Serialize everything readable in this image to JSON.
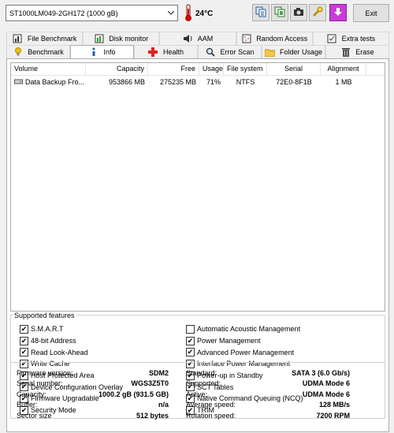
{
  "toolbar": {
    "drive": "ST1000LM049-2GH172 (1000 gB)",
    "temperature": "24°C",
    "exit_label": "Exit"
  },
  "tabs_top": [
    {
      "label": "File Benchmark",
      "icon": "file-benchmark-icon"
    },
    {
      "label": "Disk monitor",
      "icon": "disk-monitor-icon"
    },
    {
      "label": "AAM",
      "icon": "speaker-icon"
    },
    {
      "label": "Random Access",
      "icon": "random-access-icon"
    },
    {
      "label": "Extra tests",
      "icon": "extra-tests-icon"
    }
  ],
  "tabs_bottom": [
    {
      "label": "Benchmark",
      "icon": "benchmark-icon"
    },
    {
      "label": "Info",
      "icon": "info-icon",
      "active": true
    },
    {
      "label": "Health",
      "icon": "health-cross-icon"
    },
    {
      "label": "Error Scan",
      "icon": "magnifier-icon"
    },
    {
      "label": "Folder Usage",
      "icon": "folder-icon"
    },
    {
      "label": "Erase",
      "icon": "trash-icon"
    }
  ],
  "volumes": {
    "headers": [
      "Volume",
      "Capacity",
      "Free",
      "Usage",
      "File system",
      "Serial",
      "Alignment"
    ],
    "rows": [
      [
        "Data Backup Fro...",
        "953866 MB",
        "275235 MB",
        "71%",
        "NTFS",
        "72E0-8F1B",
        "1 MB"
      ]
    ]
  },
  "features": {
    "title": "Supported features",
    "left": [
      {
        "label": "S.M.A.R.T",
        "checked": true
      },
      {
        "label": "48-bit Address",
        "checked": true
      },
      {
        "label": "Read Look-Ahead",
        "checked": true
      },
      {
        "label": "Write Cache",
        "checked": true
      },
      {
        "label": "Host Protected Area",
        "checked": true
      },
      {
        "label": "Device Configuration Overlay",
        "checked": true
      },
      {
        "label": "Firmware Upgradable",
        "checked": true
      },
      {
        "label": "Security Mode",
        "checked": true
      }
    ],
    "right": [
      {
        "label": "Automatic Acoustic Management",
        "checked": false
      },
      {
        "label": "Power Management",
        "checked": true
      },
      {
        "label": "Advanced Power Management",
        "checked": true
      },
      {
        "label": "Interface Power Management",
        "checked": true
      },
      {
        "label": "Power-up in Standby",
        "checked": true
      },
      {
        "label": "SCT Tables",
        "checked": true
      },
      {
        "label": "Native Command Queuing (NCQ)",
        "checked": true
      },
      {
        "label": "TRIM",
        "checked": true
      }
    ]
  },
  "info": {
    "left": [
      {
        "label": "Firmware version:",
        "value": "SDM2"
      },
      {
        "label": "Serial number:",
        "value": "WGS3Z5T0"
      },
      {
        "label": "Capacity:",
        "value": "1000.2 gB (931.5 GB)"
      },
      {
        "label": "Buffer:",
        "value": "n/a"
      },
      {
        "label": "Sector size",
        "value": "512 bytes"
      }
    ],
    "right": [
      {
        "label": "Standard:",
        "value": "SATA 3 (6.0 Gb/s)"
      },
      {
        "label": "Supported:",
        "value": "UDMA Mode 6"
      },
      {
        "label": "Active:",
        "value": "UDMA Mode 6"
      },
      {
        "label": "Average speed:",
        "value": "128 MB/s"
      },
      {
        "label": "Rotation speed:",
        "value": "7200 RPM"
      }
    ]
  }
}
